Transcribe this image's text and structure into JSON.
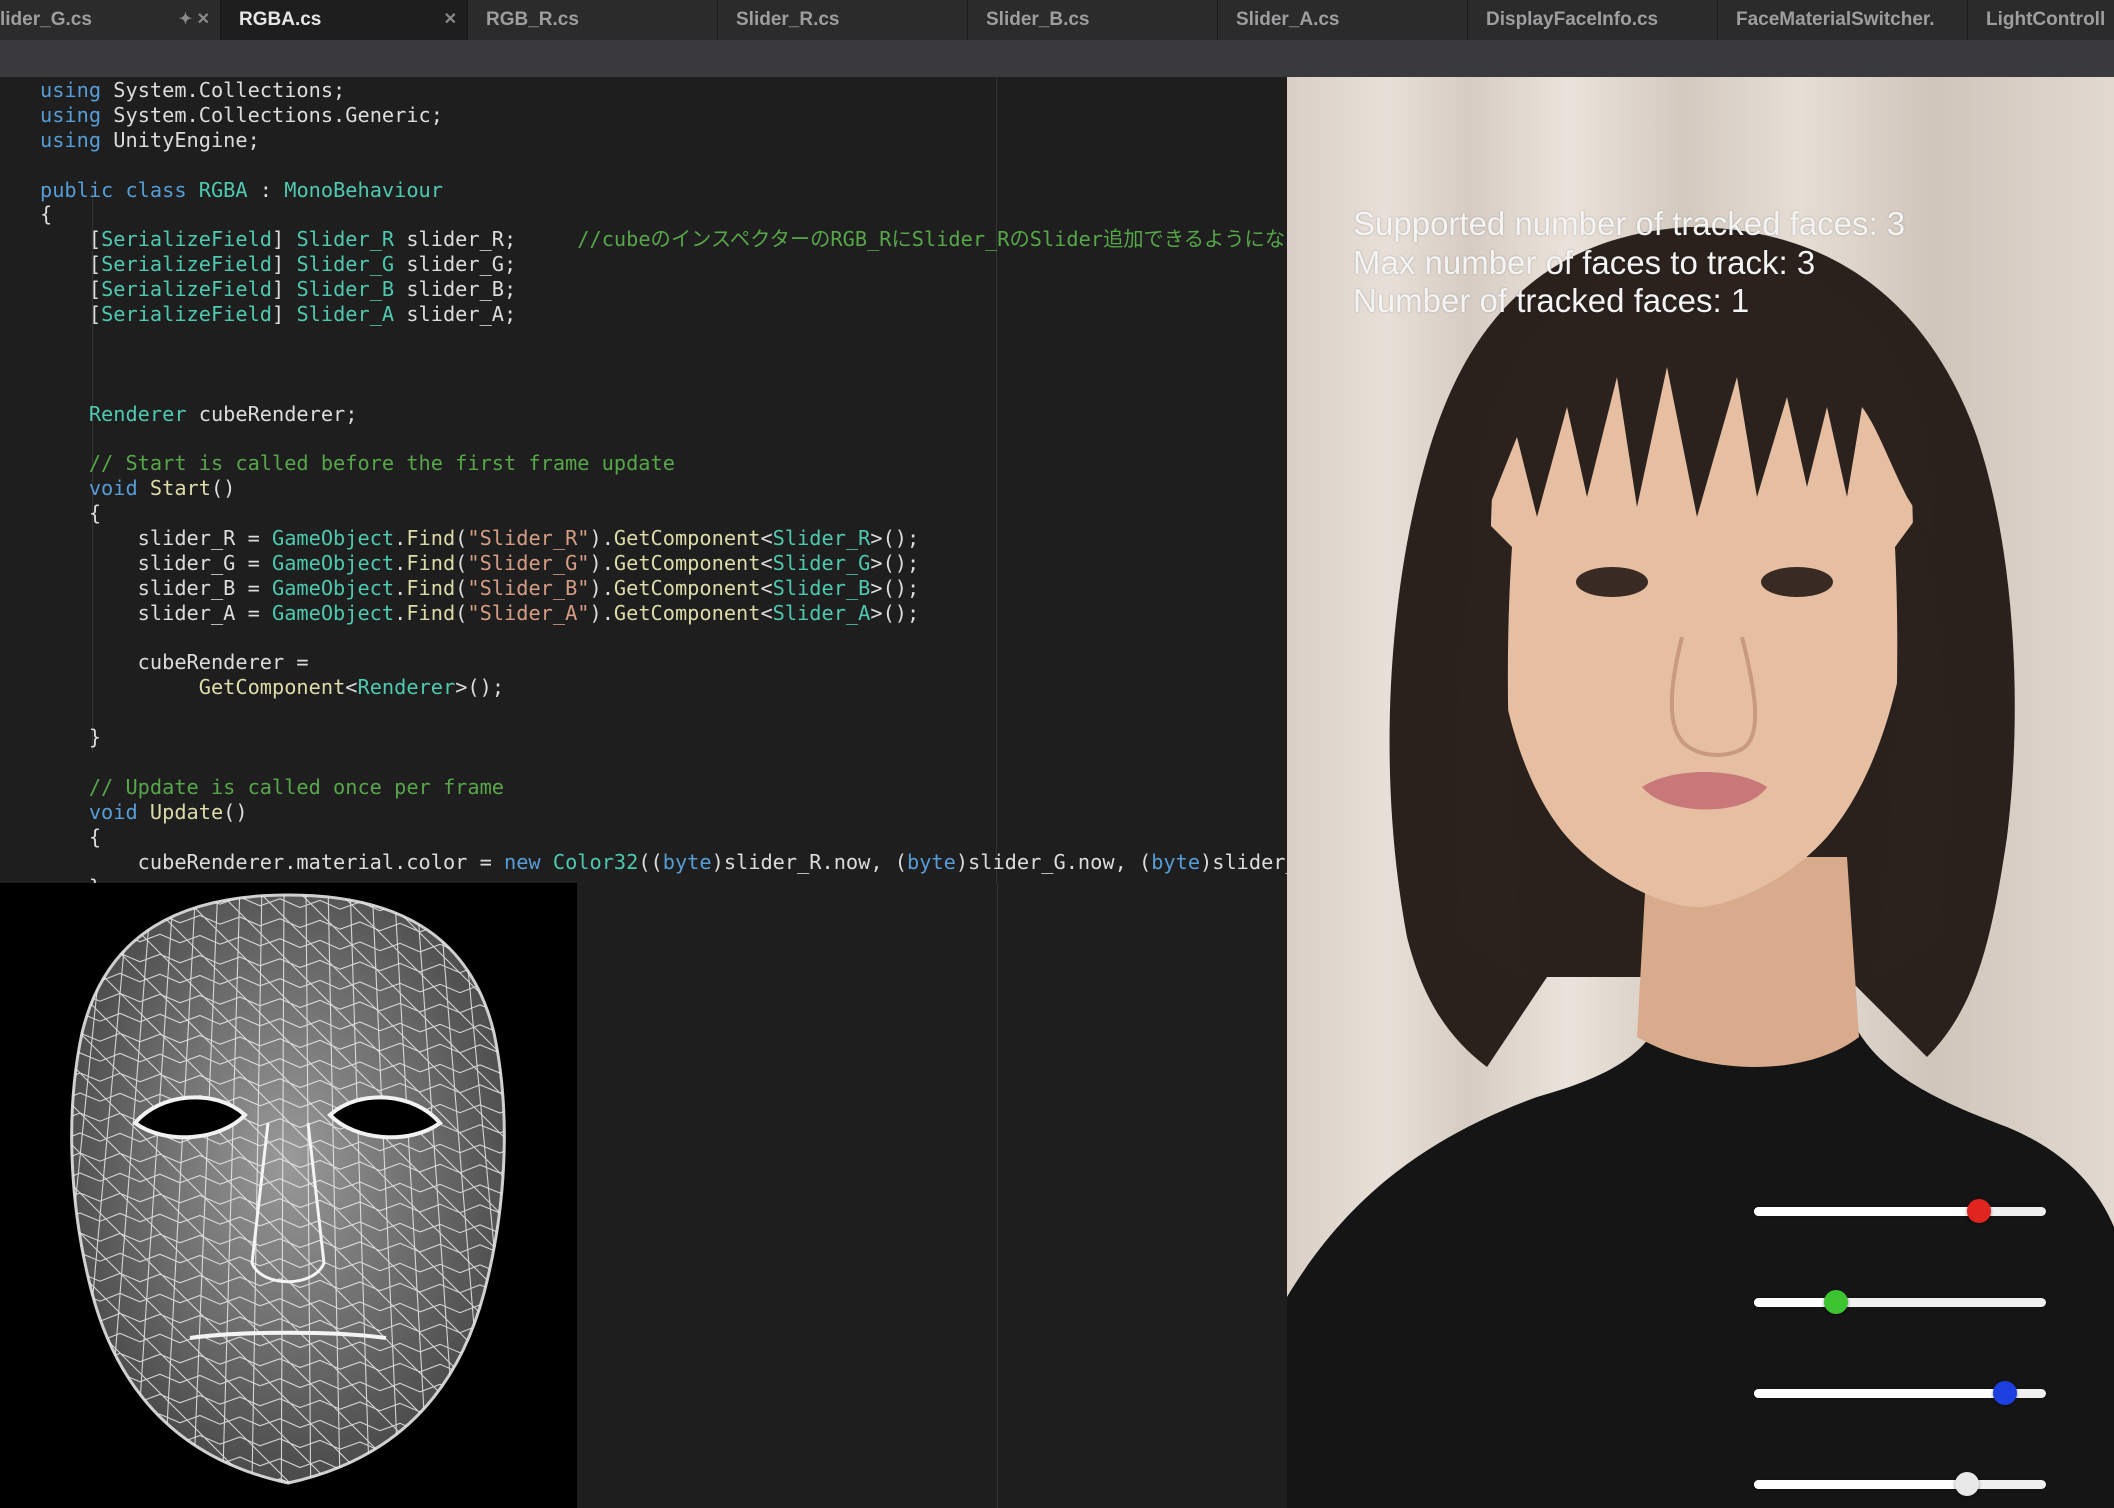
{
  "tabs": [
    {
      "label": "lider_G.cs",
      "icons": "✦ ✕"
    },
    {
      "label": "RGBA.cs",
      "icons": "✕"
    },
    {
      "label": "RGB_R.cs",
      "icons": ""
    },
    {
      "label": "Slider_R.cs",
      "icons": ""
    },
    {
      "label": "Slider_B.cs",
      "icons": ""
    },
    {
      "label": "Slider_A.cs",
      "icons": ""
    },
    {
      "label": "DisplayFaceInfo.cs",
      "icons": ""
    },
    {
      "label": "FaceMaterialSwitcher.",
      "icons": ""
    },
    {
      "label": "LightControll",
      "icons": ""
    }
  ],
  "active_tab": "RGBA.cs",
  "code_lines": [
    "<span class=\"kw\">using</span> System.Collections;",
    "<span class=\"kw\">using</span> System.Collections.Generic;",
    "<span class=\"kw\">using</span> UnityEngine;",
    "",
    "<span class=\"kw\">public class</span> <span class=\"ty\">RGBA</span> : <span class=\"ty\">MonoBehaviour</span>",
    "{",
    "    [<span class=\"ty\">SerializeField</span>] <span class=\"ty\">Slider_R</span> slider_R;     <span class=\"cm\">//cubeのインスペクターのRGB_RにSlider_RのSlider追加できるようになる</span>",
    "    [<span class=\"ty\">SerializeField</span>] <span class=\"ty\">Slider_G</span> slider_G;",
    "    [<span class=\"ty\">SerializeField</span>] <span class=\"ty\">Slider_B</span> slider_B;",
    "    [<span class=\"ty\">SerializeField</span>] <span class=\"ty\">Slider_A</span> slider_A;",
    "",
    "",
    "",
    "    <span class=\"ty\">Renderer</span> cubeRenderer;",
    "",
    "    <span class=\"cm\">// Start is called before the first frame update</span>",
    "    <span class=\"kw\">void</span> <span class=\"fn\">Start</span>()",
    "    {",
    "        slider_R = <span class=\"ty\">GameObject</span>.<span class=\"fn\">Find</span>(<span class=\"st\">\"Slider_R\"</span>).<span class=\"fn\">GetComponent</span>&lt;<span class=\"ty\">Slider_R</span>&gt;();",
    "        slider_G = <span class=\"ty\">GameObject</span>.<span class=\"fn\">Find</span>(<span class=\"st\">\"Slider_G\"</span>).<span class=\"fn\">GetComponent</span>&lt;<span class=\"ty\">Slider_G</span>&gt;();",
    "        slider_B = <span class=\"ty\">GameObject</span>.<span class=\"fn\">Find</span>(<span class=\"st\">\"Slider_B\"</span>).<span class=\"fn\">GetComponent</span>&lt;<span class=\"ty\">Slider_B</span>&gt;();",
    "        slider_A = <span class=\"ty\">GameObject</span>.<span class=\"fn\">Find</span>(<span class=\"st\">\"Slider_A\"</span>).<span class=\"fn\">GetComponent</span>&lt;<span class=\"ty\">Slider_A</span>&gt;();",
    "",
    "        cubeRenderer =",
    "             <span class=\"fn\">GetComponent</span>&lt;<span class=\"ty\">Renderer</span>&gt;();",
    "",
    "    }",
    "",
    "    <span class=\"cm\">// Update is called once per frame</span>",
    "    <span class=\"kw\">void</span> <span class=\"fn\">Update</span>()",
    "    {",
    "        cubeRenderer.material.color = <span class=\"kw\">new</span> <span class=\"ty\">Color32</span>((<span class=\"kw\">byte</span>)slider_R.now, (<span class=\"kw\">byte</span>)slider_G.now, (<span class=\"kw\">byte</span>)slider_B",
    "    }"
  ],
  "face_info": {
    "supported": "Supported number of tracked faces: 3",
    "max": "Max number of faces to track: 3",
    "tracked": "Number of tracked faces: 1"
  },
  "sliders": [
    {
      "name": "red",
      "value": 0.77,
      "color": "#e0241f"
    },
    {
      "name": "green",
      "value": 0.28,
      "color": "#3cc431"
    },
    {
      "name": "blue",
      "value": 0.86,
      "color": "#1e3fe0"
    },
    {
      "name": "alpha",
      "value": 0.73,
      "color": "#e8e8e8"
    }
  ],
  "colors": {
    "editor_bg": "#1e1e1e",
    "tabbar_bg": "#2b2b2c",
    "keyword": "#569cd6",
    "type": "#4ec9b0",
    "comment": "#57a64a",
    "string": "#d69d85",
    "method": "#dcdcaa"
  }
}
